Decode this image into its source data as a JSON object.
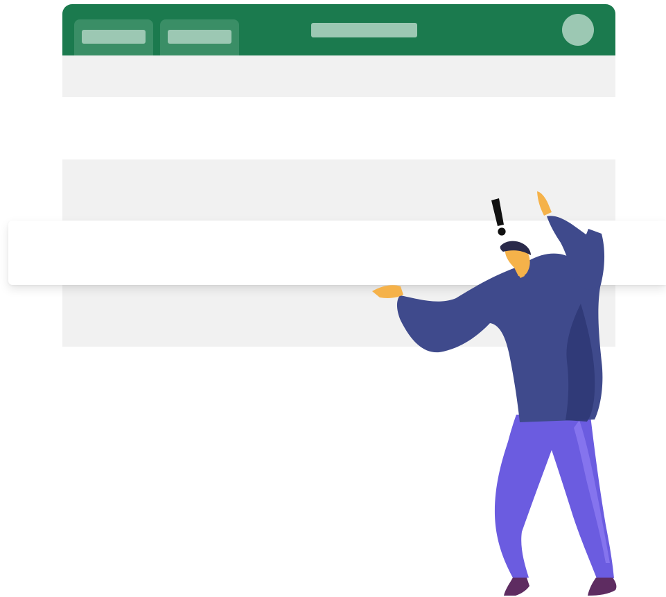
{
  "colors": {
    "header_green": "#1b7a4e",
    "tab_green": "#3a8e66",
    "placeholder_light_green": "#9cc8b3",
    "row_gray": "#f1f1f1",
    "sweater_navy": "#3f4a8c",
    "pants_purple": "#6b5ce0",
    "skin_orange": "#f5b24a",
    "hair_dark": "#2a2a4a",
    "alert_black": "#111111"
  },
  "window": {
    "tabs": [
      {
        "label": ""
      },
      {
        "label": ""
      }
    ],
    "title": "",
    "avatar_icon": "user-avatar-placeholder"
  },
  "rows": [
    {
      "style": "gray"
    },
    {
      "style": "white"
    },
    {
      "style": "gray"
    },
    {
      "style": "raised-white"
    },
    {
      "style": "gray"
    }
  ],
  "illustration": {
    "subject": "person-lifting-row",
    "alert": "!"
  }
}
